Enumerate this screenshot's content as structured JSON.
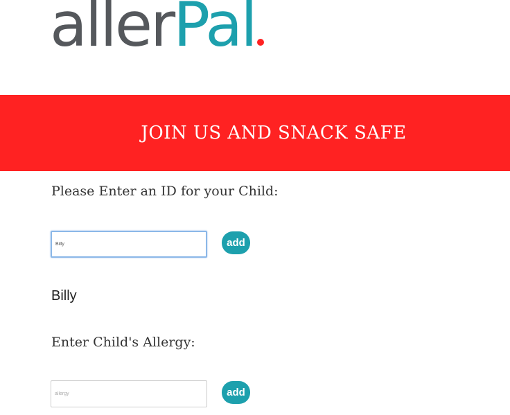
{
  "colors": {
    "brand_gray": "#55585c",
    "brand_teal": "#1da0ad",
    "accent_red": "#ff2222",
    "button": "#1da0ad"
  },
  "logo": {
    "part1": "aller",
    "part2": "Pal"
  },
  "banner": {
    "text": "JOIN US AND SNACK SAFE"
  },
  "child_id": {
    "label": "Please Enter an ID for your Child:",
    "value": "Billy",
    "button_label": "add"
  },
  "entered_child": "Billy",
  "allergy": {
    "label": "Enter Child's Allergy:",
    "placeholder": "allergy",
    "button_label": "add"
  }
}
